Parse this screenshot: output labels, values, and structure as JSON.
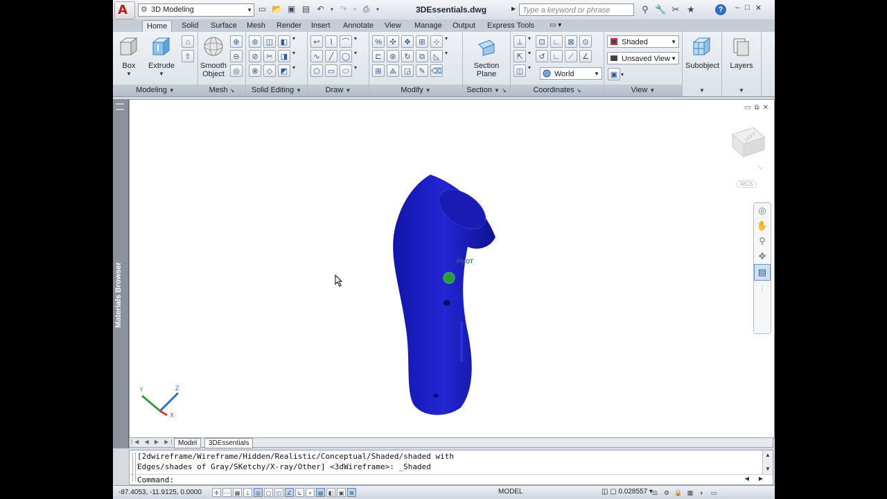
{
  "window": {
    "workspace": "3D Modeling",
    "doc_title": "3DEssentials.dwg",
    "search_placeholder": "Type a keyword or phrase",
    "win_buttons": [
      "–",
      "□",
      "✕"
    ]
  },
  "tabs": [
    "Home",
    "Solid",
    "Surface",
    "Mesh",
    "Render",
    "Insert",
    "Annotate",
    "View",
    "Manage",
    "Output",
    "Express Tools"
  ],
  "active_tab": "Home",
  "ribbon": {
    "modeling": {
      "title": "Modeling",
      "box": "Box",
      "extrude": "Extrude"
    },
    "mesh": {
      "title": "Mesh",
      "smooth1": "Smooth",
      "smooth2": "Object"
    },
    "solid_editing": {
      "title": "Solid Editing"
    },
    "draw": {
      "title": "Draw"
    },
    "modify": {
      "title": "Modify"
    },
    "section": {
      "title": "Section",
      "plane1": "Section",
      "plane2": "Plane"
    },
    "coordinates": {
      "title": "Coordinates",
      "world": "World"
    },
    "view": {
      "title": "View",
      "visual_style": "Shaded",
      "named_view": "Unsaved View"
    },
    "subobject": {
      "label": "Subobject"
    },
    "layers": {
      "label": "Layers"
    }
  },
  "viewport": {
    "materials_browser": "Materials Browser",
    "pivot_label": "PIVOT",
    "cube_face": "LEFT",
    "wcs": "WCS",
    "ucs_axes": [
      "Y",
      "Z",
      "X"
    ],
    "model_color": "#1c1dbd"
  },
  "layout_tabs": [
    "Model",
    "3DEssentials"
  ],
  "command": {
    "line1": "[2dwireframe/Wireframe/Hidden/Realistic/Conceptual/Shaded/shaded with",
    "line2": "Edges/shades of Gray/SKetchy/X-ray/Other] <3dWireframe>: _Shaded",
    "prompt": "Command:"
  },
  "status": {
    "coords": "-87.4053, -11.9125, 0.0000",
    "model": "MODEL",
    "scale": "0.028557"
  }
}
